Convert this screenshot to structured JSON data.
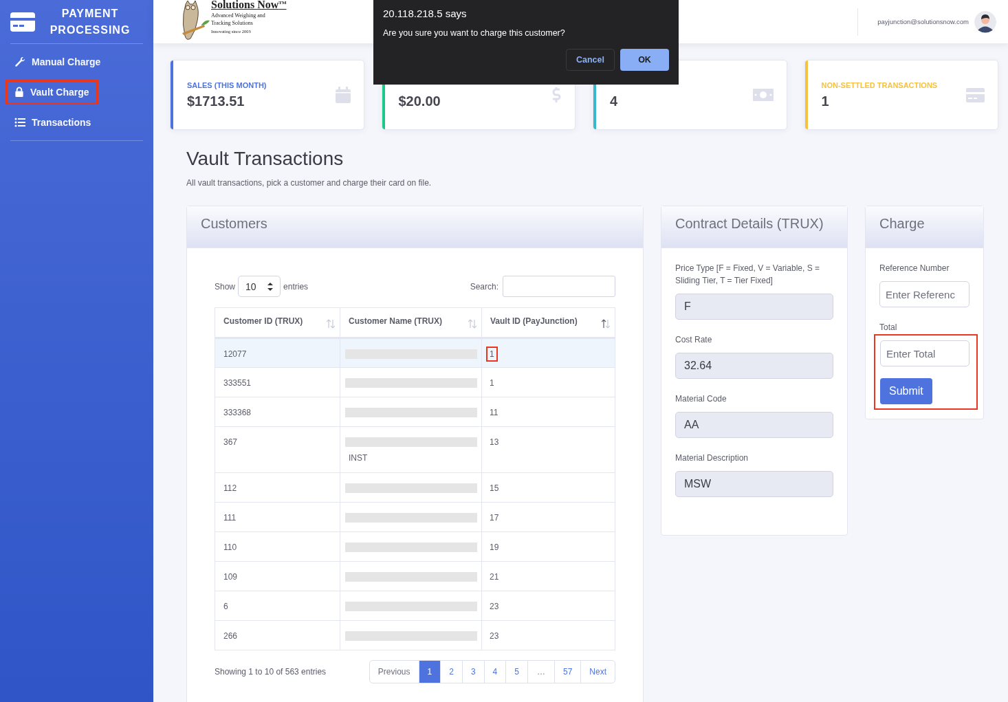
{
  "sidebar": {
    "brand": "PAYMENT PROCESSING",
    "items": [
      {
        "label": "Manual Charge",
        "highlighted": false
      },
      {
        "label": "Vault Charge",
        "highlighted": true
      },
      {
        "label": "Transactions",
        "highlighted": false
      }
    ]
  },
  "topbar": {
    "logo": {
      "name": "Solutions Now",
      "mark": "TM",
      "tagline": "Advanced Weighing and Tracking Solutions",
      "since": "Innovating since 2003"
    },
    "user_email": "payjunction@solutionsnow.com"
  },
  "dialog": {
    "title": "20.118.218.5 says",
    "message": "Are you sure you want to charge this customer?",
    "buttons": [
      {
        "label": "Cancel",
        "kind": "secondary"
      },
      {
        "label": "OK",
        "kind": "primary"
      }
    ]
  },
  "stat_cards": [
    {
      "label": "SALES (THIS MONTH)",
      "value": "$1713.51",
      "color": "#4e73df"
    },
    {
      "value": "$20.00",
      "color": "#1cc88a"
    },
    {
      "value": "4",
      "color": "#36b9cc"
    },
    {
      "label": "NON-SETTLED TRANSACTIONS",
      "value": "1",
      "color": "#f6c23e"
    }
  ],
  "page": {
    "title": "Vault Transactions",
    "subtitle": "All vault transactions, pick a customer and charge their card on file."
  },
  "customers": {
    "title": "Customers",
    "length_label": "Show",
    "length_value": "10",
    "length_suffix": "entries",
    "search_label": "Search:",
    "columns": [
      {
        "label": "Customer ID (TRUX)",
        "sorted": false
      },
      {
        "label": "Customer Name (TRUX)",
        "sorted": false
      },
      {
        "label": "Vault ID (PayJunction)",
        "sorted": true
      }
    ],
    "rows": [
      {
        "id": "12077",
        "name_redacted": true,
        "name_extra": null,
        "vault_id": "1",
        "selected": true,
        "highlighted": true
      },
      {
        "id": "333551",
        "name_redacted": true,
        "name_extra": null,
        "vault_id": "1",
        "selected": false,
        "highlighted": false
      },
      {
        "id": "333368",
        "name_redacted": true,
        "name_extra": null,
        "vault_id": "11",
        "selected": false,
        "highlighted": false
      },
      {
        "id": "367",
        "name_redacted": true,
        "name_extra": "INST",
        "vault_id": "13",
        "selected": false,
        "highlighted": false
      },
      {
        "id": "112",
        "name_redacted": true,
        "name_extra": null,
        "vault_id": "15",
        "selected": false,
        "highlighted": false
      },
      {
        "id": "111",
        "name_redacted": true,
        "name_extra": null,
        "vault_id": "17",
        "selected": false,
        "highlighted": false
      },
      {
        "id": "110",
        "name_redacted": true,
        "name_extra": null,
        "vault_id": "19",
        "selected": false,
        "highlighted": false
      },
      {
        "id": "109",
        "name_redacted": true,
        "name_extra": null,
        "vault_id": "21",
        "selected": false,
        "highlighted": false
      },
      {
        "id": "6",
        "name_redacted": true,
        "name_extra": null,
        "vault_id": "23",
        "selected": false,
        "highlighted": false
      },
      {
        "id": "266",
        "name_redacted": true,
        "name_extra": null,
        "vault_id": "23",
        "selected": false,
        "highlighted": false
      }
    ],
    "info": "Showing 1 to 10 of 563 entries",
    "pagination": [
      {
        "label": "Previous",
        "kind": "nav",
        "selected": false
      },
      {
        "label": "1",
        "kind": "page",
        "selected": true
      },
      {
        "label": "2",
        "kind": "page",
        "selected": false
      },
      {
        "label": "3",
        "kind": "page",
        "selected": false
      },
      {
        "label": "4",
        "kind": "page",
        "selected": false
      },
      {
        "label": "5",
        "kind": "page",
        "selected": false
      },
      {
        "label": "…",
        "kind": "ellipsis",
        "selected": false
      },
      {
        "label": "57",
        "kind": "page",
        "selected": false
      },
      {
        "label": "Next",
        "kind": "next",
        "selected": false
      }
    ]
  },
  "contract": {
    "title": "Contract Details (TRUX)",
    "fields": [
      {
        "label": "Price Type [F = Fixed, V = Variable, S = Sliding Tier, T = Tier Fixed]",
        "value": "F"
      },
      {
        "label": "Cost Rate",
        "value": "32.64"
      },
      {
        "label": "Material Code",
        "value": "AA"
      },
      {
        "label": "Material Description",
        "value": "MSW"
      }
    ]
  },
  "charge": {
    "title": "Charge",
    "fields": [
      {
        "label": "Reference Number",
        "placeholder": "Enter Referenc"
      },
      {
        "label": "Total",
        "placeholder": "Enter Total"
      }
    ],
    "submit": "Submit",
    "highlighted": true
  }
}
